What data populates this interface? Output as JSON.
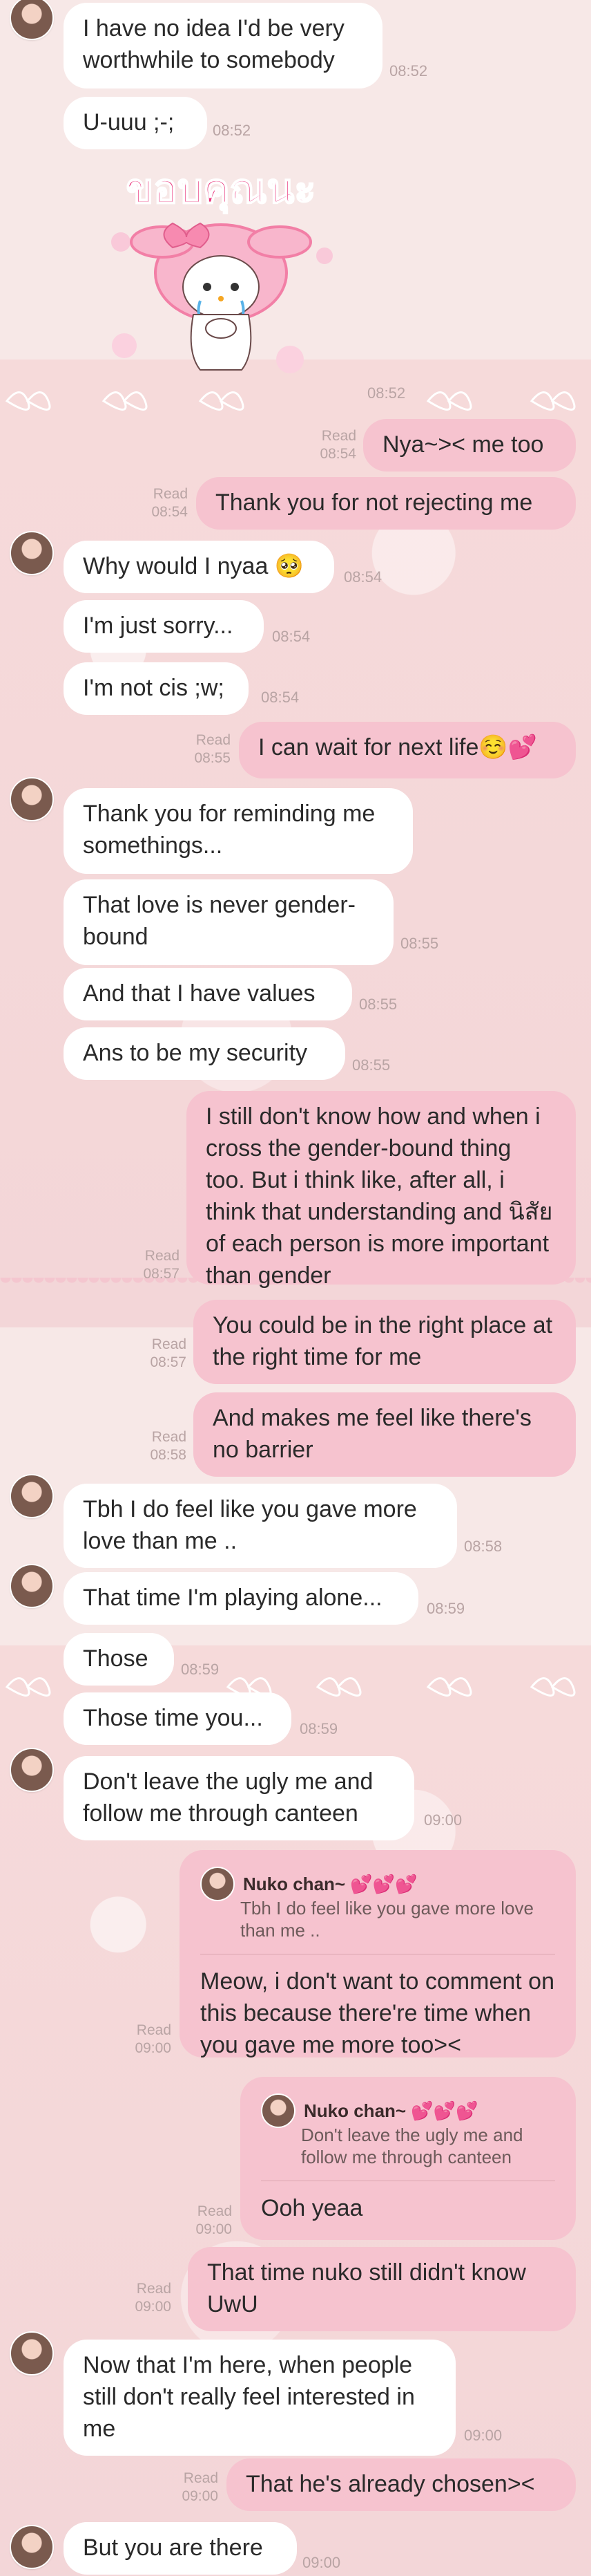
{
  "sticker": {
    "text": "ขอบคุณนะ"
  },
  "messages": {
    "m1": {
      "text": "I have no idea I'd be very worthwhile to somebody",
      "time": "08:52"
    },
    "m2": {
      "text": "U-uuu ;-;",
      "time": "08:52"
    },
    "m3": {
      "time": "08:52"
    },
    "m4": {
      "text": "Nya~>< me too",
      "read": "Read",
      "time": "08:54"
    },
    "m5": {
      "text": "Thank you for not rejecting me",
      "read": "Read",
      "time": "08:54"
    },
    "m6": {
      "text": "Why would I nyaa 🥺",
      "time": "08:54"
    },
    "m7": {
      "text": "I'm just sorry...",
      "time": "08:54"
    },
    "m8": {
      "text": "I'm not cis ;w;",
      "time": "08:54"
    },
    "m9": {
      "text": "I can wait for next life☺️💕",
      "read": "Read",
      "time": "08:55"
    },
    "m10": {
      "text": "Thank you for reminding me somethings...",
      "time": "08:55"
    },
    "m11": {
      "text": "That love is never gender-bound",
      "time": "08:55"
    },
    "m12": {
      "text": "And that I have values",
      "time": "08:55"
    },
    "m13": {
      "text": "Ans to be my security",
      "time": "08:55"
    },
    "m14": {
      "text": "I still don't know how and when i cross the gender-bound thing too. But i think like, after all, i think that understanding and นิสัย of each person is more important than gender",
      "read": "Read",
      "time": "08:57"
    },
    "m15": {
      "text": "You could be in the right place at the right time for me",
      "read": "Read",
      "time": "08:57"
    },
    "m16": {
      "text": "And makes me feel like there's no barrier",
      "read": "Read",
      "time": "08:58"
    },
    "m17": {
      "text": "Tbh I do feel like you gave more love than me ..",
      "time": "08:58"
    },
    "m18": {
      "text": "That time I'm playing alone...",
      "time": "08:59"
    },
    "m19": {
      "text": "Those",
      "time": "08:59"
    },
    "m20": {
      "text": "Those time you...",
      "time": "08:59"
    },
    "m21": {
      "text": "Don't leave the ugly me and follow me through canteen",
      "time": "09:00"
    },
    "m22": {
      "reply_name": "Nuko chan~ 💕💕💕",
      "reply_text": "Tbh I do feel like you gave more love than me ..",
      "text": "Meow, i don't want to comment on this because there're time when you gave me more too><",
      "read": "Read",
      "time": "09:00"
    },
    "m23": {
      "reply_name": "Nuko chan~ 💕💕💕",
      "reply_text": "Don't leave the ugly me and follow me through canteen",
      "text": "Ooh yeaa",
      "read": "Read",
      "time": "09:00"
    },
    "m24": {
      "text": "That time nuko still didn't know UwU",
      "read": "Read",
      "time": "09:00"
    },
    "m25": {
      "text": "Now that I'm here, when people still don't really feel interested in me",
      "time": "09:00"
    },
    "m26": {
      "text": "That he's already chosen><",
      "read": "Read",
      "time": "09:00"
    },
    "m27": {
      "text": "But you are there",
      "time": "09:00"
    }
  }
}
